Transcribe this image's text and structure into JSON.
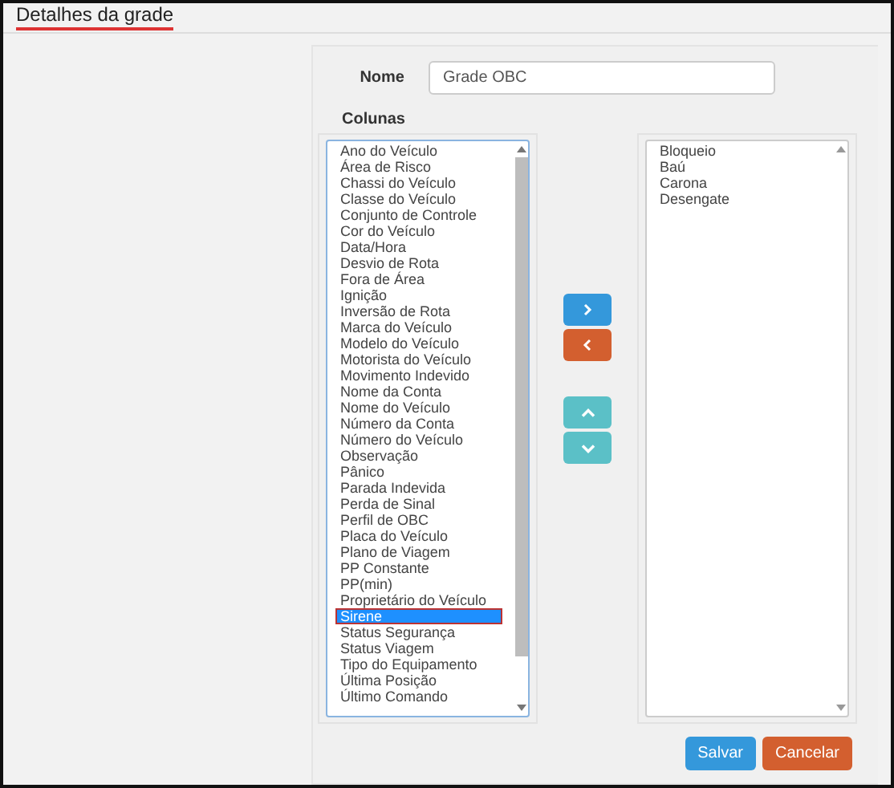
{
  "header": {
    "title": "Detalhes da grade"
  },
  "form": {
    "name_label": "Nome",
    "name_value": "Grade OBC",
    "columns_label": "Colunas"
  },
  "available_columns": [
    {
      "label": "Ano do Veículo",
      "selected": false
    },
    {
      "label": "Área de Risco",
      "selected": false
    },
    {
      "label": "Chassi do Veículo",
      "selected": false
    },
    {
      "label": "Classe do Veículo",
      "selected": false
    },
    {
      "label": "Conjunto de Controle",
      "selected": false
    },
    {
      "label": "Cor do Veículo",
      "selected": false
    },
    {
      "label": "Data/Hora",
      "selected": false
    },
    {
      "label": "Desvio de Rota",
      "selected": false
    },
    {
      "label": "Fora de Área",
      "selected": false
    },
    {
      "label": "Ignição",
      "selected": false
    },
    {
      "label": "Inversão de Rota",
      "selected": false
    },
    {
      "label": "Marca do Veículo",
      "selected": false
    },
    {
      "label": "Modelo do Veículo",
      "selected": false
    },
    {
      "label": "Motorista do Veículo",
      "selected": false
    },
    {
      "label": "Movimento Indevido",
      "selected": false
    },
    {
      "label": "Nome da Conta",
      "selected": false
    },
    {
      "label": "Nome do Veículo",
      "selected": false
    },
    {
      "label": "Número da Conta",
      "selected": false
    },
    {
      "label": "Número do Veículo",
      "selected": false
    },
    {
      "label": "Observação",
      "selected": false
    },
    {
      "label": "Pânico",
      "selected": false
    },
    {
      "label": "Parada Indevida",
      "selected": false
    },
    {
      "label": "Perda de Sinal",
      "selected": false
    },
    {
      "label": "Perfil de OBC",
      "selected": false
    },
    {
      "label": "Placa do Veículo",
      "selected": false
    },
    {
      "label": "Plano de Viagem",
      "selected": false
    },
    {
      "label": "PP Constante",
      "selected": false
    },
    {
      "label": "PP(min)",
      "selected": false
    },
    {
      "label": "Proprietário do Veículo",
      "selected": false
    },
    {
      "label": "Sirene",
      "selected": true
    },
    {
      "label": "Status Segurança",
      "selected": false
    },
    {
      "label": "Status Viagem",
      "selected": false
    },
    {
      "label": "Tipo do Equipamento",
      "selected": false
    },
    {
      "label": "Última Posição",
      "selected": false
    },
    {
      "label": "Último Comando",
      "selected": false
    }
  ],
  "chosen_columns": [
    {
      "label": "Bloqueio",
      "selected": false
    },
    {
      "label": "Baú",
      "selected": false
    },
    {
      "label": "Carona",
      "selected": false
    },
    {
      "label": "Desengate",
      "selected": false
    }
  ],
  "buttons": [
    {
      "label": "Salvar",
      "kind": "primary"
    },
    {
      "label": "Cancelar",
      "kind": "danger"
    }
  ]
}
